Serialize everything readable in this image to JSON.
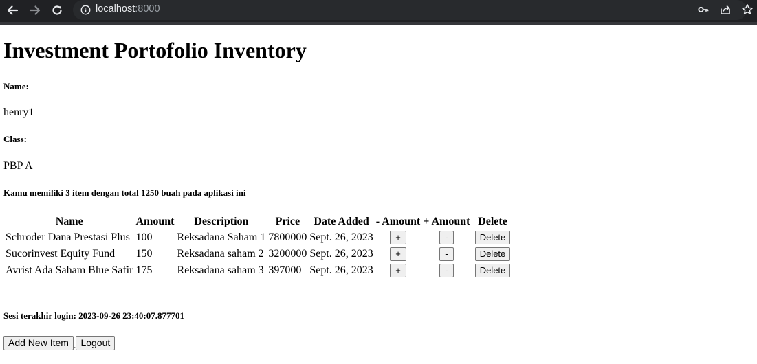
{
  "browser": {
    "url_host": "localhost",
    "url_port": ":8000"
  },
  "page": {
    "title": "Investment Portofolio Inventory",
    "name_label": "Name:",
    "name_value": "henry1",
    "class_label": "Class:",
    "class_value": "PBP A",
    "summary": "Kamu memiliki 3 item dengan total 1250 buah pada aplikasi ini",
    "last_login": "Sesi terakhir login: 2023-09-26 23:40:07.877701"
  },
  "table": {
    "headers": [
      "Name",
      "Amount",
      "Description",
      "Price",
      "Date Added",
      "- Amount",
      "+ Amount",
      "Delete"
    ],
    "rows": [
      {
        "name": "Schroder Dana Prestasi Plus",
        "amount": "100",
        "description": "Reksadana Saham 1",
        "price": "7800000",
        "date": "Sept. 26, 2023"
      },
      {
        "name": "Sucorinvest Equity Fund",
        "amount": "150",
        "description": "Reksadana saham 2",
        "price": "3200000",
        "date": "Sept. 26, 2023"
      },
      {
        "name": "Avrist Ada Saham Blue Safir",
        "amount": "175",
        "description": "Reksadana saham 3",
        "price": "397000",
        "date": "Sept. 26, 2023"
      }
    ],
    "plus_label": "+",
    "minus_label": "-",
    "delete_label": "Delete"
  },
  "actions": {
    "add_label": "Add New Item",
    "separator": ".",
    "logout_label": "Logout"
  },
  "colors": {
    "chrome_bg": "#202124",
    "omnibox_bg": "#282a2d",
    "button_bg": "#efefef"
  }
}
